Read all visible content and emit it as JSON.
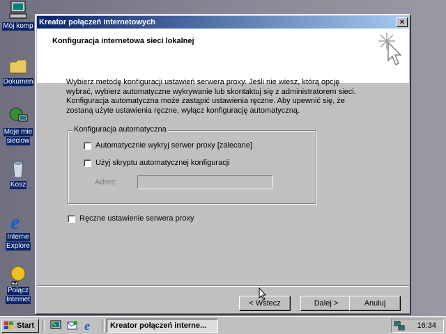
{
  "desktop": {
    "icons": [
      {
        "label": "Mój komp",
        "icon": "computer-icon"
      },
      {
        "label": "Dokumen",
        "icon": "folder-icon"
      },
      {
        "label": "Moje mie",
        "label2": "sieciow",
        "icon": "network-icon"
      },
      {
        "label": "Kosz",
        "icon": "recycle-bin-icon"
      },
      {
        "label": "Interne",
        "label2": "Explore",
        "icon": "internet-explorer-icon"
      },
      {
        "label": "Połącz",
        "label2": "Internet",
        "icon": "connect-internet-icon"
      }
    ]
  },
  "dialog": {
    "title": "Kreator połączeń internetowych",
    "close_label": "×",
    "header_title": "Konfiguracja internetowa sieci lokalnej",
    "description": "Wybierz metodę konfiguracji ustawień serwera proxy. Jeśli nie wiesz, którą opcję wybrać, wybierz automatyczne wykrywanie lub skontaktuj się z administratorem sieci. Konfiguracja automatyczna może zastąpić ustawienia ręczne. Aby upewnić się, że zostaną użyte ustawienia ręczne, wyłącz konfigurację automatyczną.",
    "auto_group_label": "Konfiguracja automatyczna",
    "auto_detect_label": "Automatycznie wykryj serwer proxy [zalecane]",
    "auto_detect_checked": false,
    "use_script_label": "Użyj skryptu automatycznej konfiguracji",
    "use_script_checked": false,
    "address_label": "Adres:",
    "address_value": "",
    "manual_proxy_label": "Ręczne ustawienie serwera proxy",
    "manual_proxy_checked": false,
    "buttons": {
      "back": "< Wstecz",
      "next": "Dalej >",
      "cancel": "Anuluj"
    }
  },
  "taskbar": {
    "start_label": "Start",
    "quick_launch": [
      "show-desktop-icon",
      "outlook-express-icon",
      "internet-explorer-icon"
    ],
    "active_task": "Kreator połączeń interne...",
    "clock": "16:34"
  },
  "colors": {
    "title_active": "#0a246a",
    "title_gradient_end": "#a6caf0",
    "face": "#c0c0c0"
  }
}
